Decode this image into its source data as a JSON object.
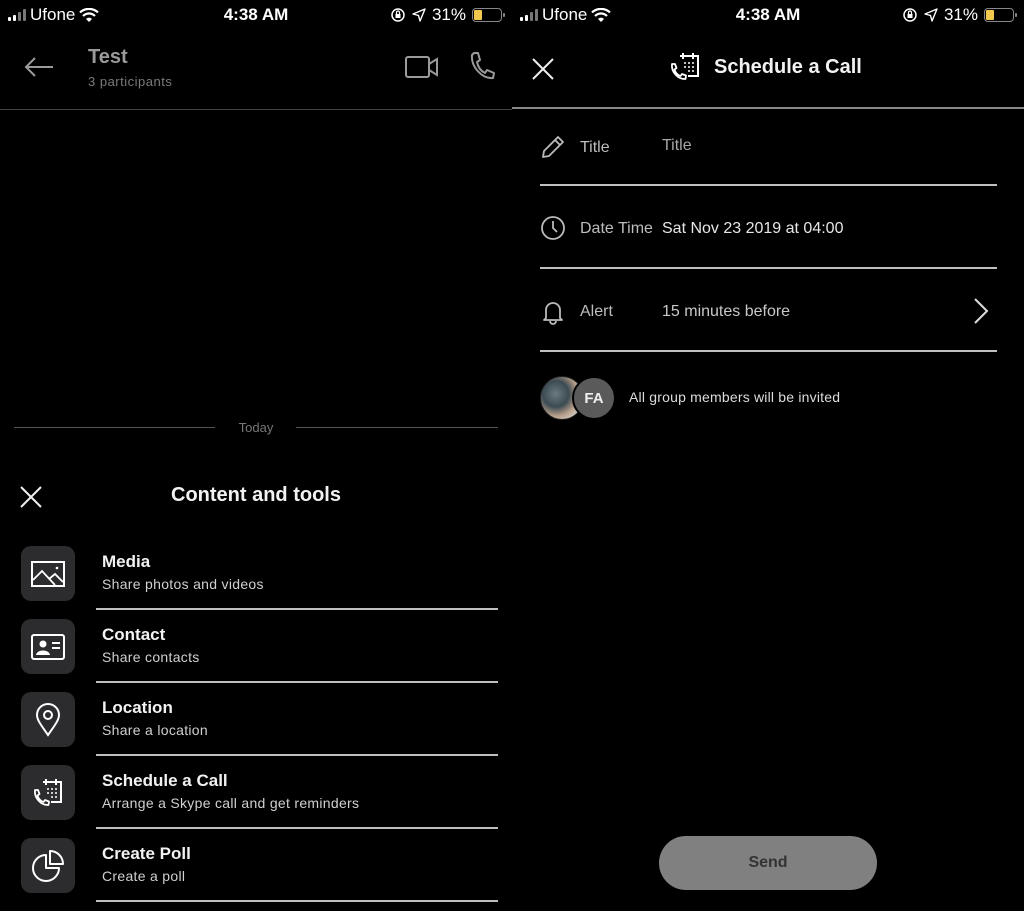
{
  "status_bar": {
    "carrier": "Ufone",
    "time": "4:38 AM",
    "battery_percent": "31%",
    "battery_level": 0.31,
    "icons": [
      "signal-icon",
      "wifi-icon",
      "orientation-lock-icon",
      "location-arrow-icon",
      "battery-icon"
    ]
  },
  "chat": {
    "title": "Test",
    "subtitle": "3 participants",
    "date_divider": "Today"
  },
  "content_tools": {
    "title": "Content and tools",
    "items": [
      {
        "icon": "image-icon",
        "label": "Media",
        "description": "Share photos and videos"
      },
      {
        "icon": "contact-card-icon",
        "label": "Contact",
        "description": "Share contacts"
      },
      {
        "icon": "location-pin-icon",
        "label": "Location",
        "description": "Share a location"
      },
      {
        "icon": "schedule-call-icon",
        "label": "Schedule a Call",
        "description": "Arrange a Skype call and get reminders"
      },
      {
        "icon": "poll-icon",
        "label": "Create Poll",
        "description": "Create a poll"
      }
    ]
  },
  "schedule": {
    "title": "Schedule a Call",
    "fields": {
      "title": {
        "label": "Title",
        "placeholder": "Title",
        "value": ""
      },
      "datetime": {
        "label": "Date Time",
        "value": "Sat Nov 23 2019 at 04:00"
      },
      "alert": {
        "label": "Alert",
        "value": "15 minutes before"
      }
    },
    "invite": {
      "initials": "FA",
      "text": "All group members will be invited"
    },
    "send_label": "Send"
  },
  "colors": {
    "background": "#000000",
    "tile": "#2c2c2e",
    "battery": "#f2c94c",
    "send_button": "#808080"
  }
}
